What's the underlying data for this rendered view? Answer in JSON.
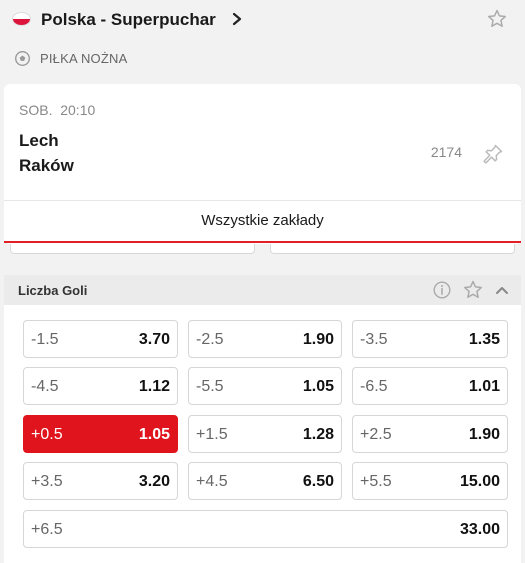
{
  "header": {
    "league_title": "Polska - Superpuchar",
    "flag": "poland-flag",
    "sport_label": "PIŁKA NOŻNA"
  },
  "event": {
    "time": "SOB.  20:10",
    "team_home": "Lech",
    "team_away": "Raków",
    "code": "2174"
  },
  "tabs": {
    "active_label": "Wszystkie zakłady"
  },
  "market": {
    "title": "Liczba Goli",
    "odds": [
      {
        "label": "-1.5",
        "value": "3.70",
        "selected": false
      },
      {
        "label": "-2.5",
        "value": "1.90",
        "selected": false
      },
      {
        "label": "-3.5",
        "value": "1.35",
        "selected": false
      },
      {
        "label": "-4.5",
        "value": "1.12",
        "selected": false
      },
      {
        "label": "-5.5",
        "value": "1.05",
        "selected": false
      },
      {
        "label": "-6.5",
        "value": "1.01",
        "selected": false
      },
      {
        "label": "+0.5",
        "value": "1.05",
        "selected": true
      },
      {
        "label": "+1.5",
        "value": "1.28",
        "selected": false
      },
      {
        "label": "+2.5",
        "value": "1.90",
        "selected": false
      },
      {
        "label": "+3.5",
        "value": "3.20",
        "selected": false
      },
      {
        "label": "+4.5",
        "value": "6.50",
        "selected": false
      },
      {
        "label": "+5.5",
        "value": "15.00",
        "selected": false
      },
      {
        "label": "+6.5",
        "value": "33.00",
        "selected": false
      }
    ]
  },
  "colors": {
    "accent_red": "#e0141c",
    "background": "#f2f2f2"
  }
}
